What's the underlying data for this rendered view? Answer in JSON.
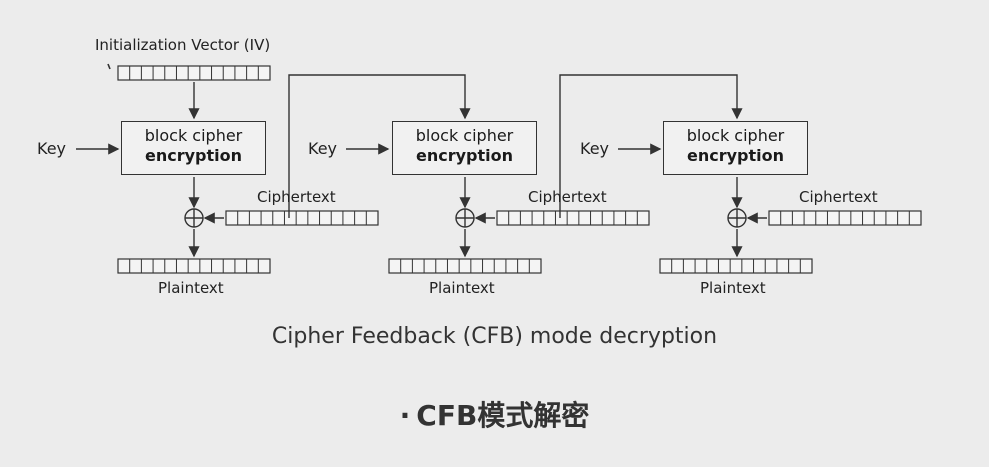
{
  "diagram": {
    "iv_label": "Initialization Vector (IV)",
    "key_label": "Key",
    "block_line1": "block cipher",
    "block_line2": "encryption",
    "ciphertext_label": "Ciphertext",
    "plaintext_label": "Plaintext",
    "caption": "Cipher Feedback (CFB) mode decryption",
    "xor_symbol": "⊕"
  },
  "slide": {
    "bullet": "·",
    "title": "CFB模式解密"
  },
  "colors": {
    "background": "#ececec",
    "stroke": "#333333"
  }
}
